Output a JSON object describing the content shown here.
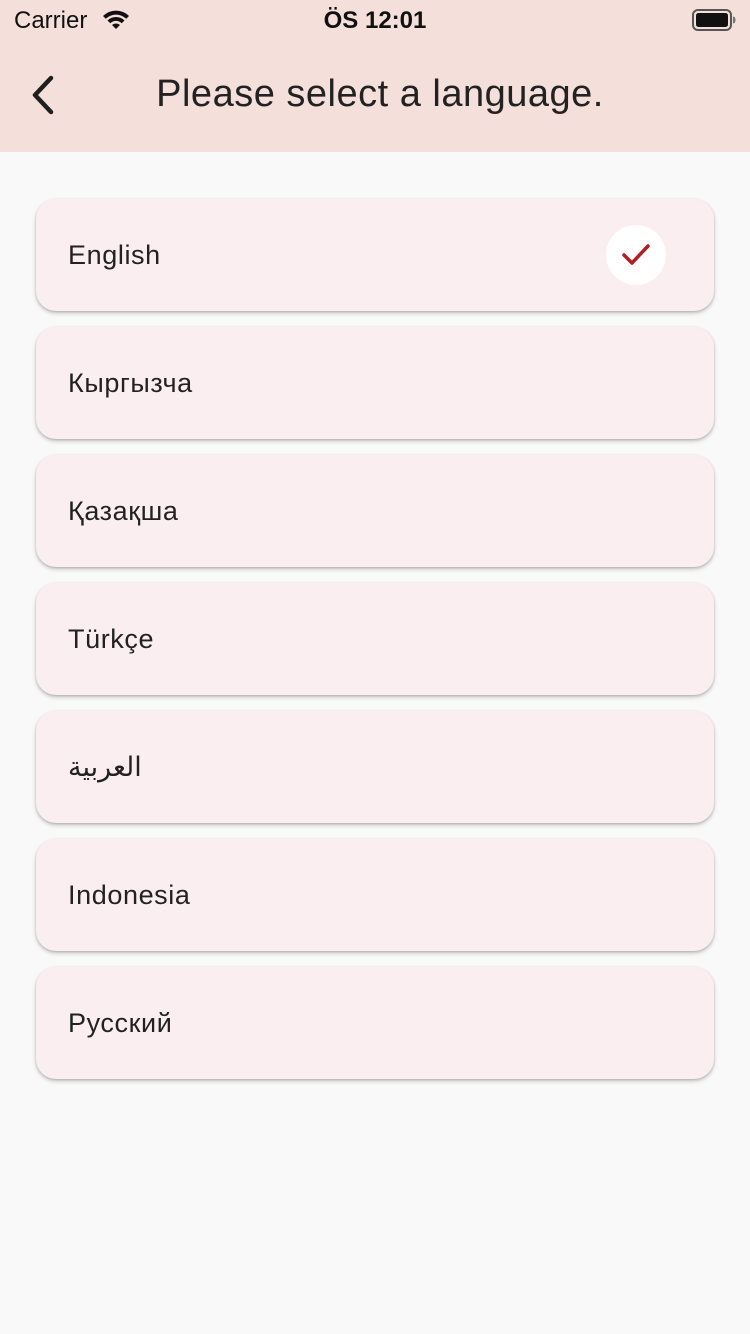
{
  "status_bar": {
    "carrier": "Carrier",
    "time": "ÖS 12:01",
    "wifi_icon": "wifi-icon",
    "battery_icon": "battery-icon"
  },
  "nav": {
    "back_icon": "chevron-left-icon",
    "title": "Please select a language."
  },
  "languages": [
    {
      "label": "English",
      "selected": true
    },
    {
      "label": "Кыргызча",
      "selected": false
    },
    {
      "label": "Қазақша",
      "selected": false
    },
    {
      "label": "Türkçe",
      "selected": false
    },
    {
      "label": "العربية",
      "selected": false
    },
    {
      "label": "Indonesia",
      "selected": false
    },
    {
      "label": "Русский",
      "selected": false
    }
  ],
  "selected_icon": "checkmark-icon",
  "colors": {
    "header_background": "#f5dfdb",
    "page_background": "#f9f9f9",
    "item_background": "#faeef0",
    "check_color": "#b01e22"
  }
}
